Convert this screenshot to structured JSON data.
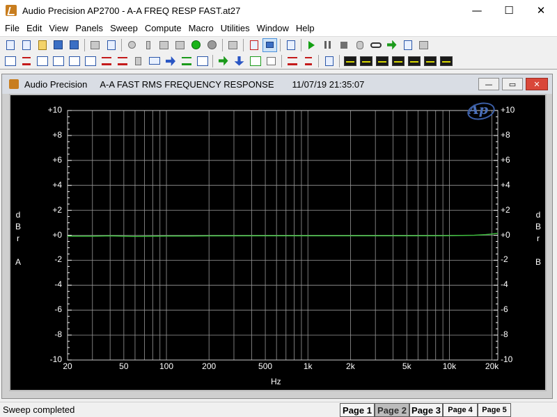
{
  "window": {
    "title": "Audio Precision AP2700 - A-A FREQ RESP FAST.at27",
    "minimize": "—",
    "maximize": "☐",
    "close": "✕"
  },
  "menu": [
    "File",
    "Edit",
    "View",
    "Panels",
    "Sweep",
    "Compute",
    "Macro",
    "Utilities",
    "Window",
    "Help"
  ],
  "toolbar_icons_row1": [
    "new-document",
    "open-document",
    "open-folder",
    "save",
    "save-all",
    "print",
    "print-preview",
    "undo",
    "cut",
    "copy",
    "paste",
    "go-green",
    "stop-gray",
    "settings-panel",
    "record",
    "panel-active",
    "configure",
    "play",
    "pause",
    "stop",
    "hand",
    "glasses",
    "export",
    "import",
    "clipboard"
  ],
  "toolbar_icons_row2": [
    "generator",
    "analyzer",
    "filter",
    "switcher",
    "sync",
    "bits",
    "dsp",
    "waveform",
    "speaker",
    "dcx",
    "digital-io",
    "multitone",
    "compute-cell",
    "arrow-right",
    "arrow-down",
    "graph-view",
    "spreadsheet",
    "bargraph",
    "tree",
    "notes",
    "graph-1",
    "graph-2",
    "graph-3",
    "graph-4",
    "graph-5",
    "graph-6",
    "graph-7"
  ],
  "child_window": {
    "app_name": "Audio Precision",
    "heading": "A-A FAST RMS FREQUENCY RESPONSE",
    "timestamp": "11/07/19 21:35:07",
    "minimize": "—",
    "restore": "▭",
    "close": "✕"
  },
  "chart_data": {
    "type": "line",
    "title": "A-A FAST RMS FREQUENCY RESPONSE",
    "xlabel": "Hz",
    "ylabel_left": [
      "d",
      "B",
      "r",
      "",
      "A"
    ],
    "ylabel_right": [
      "d",
      "B",
      "r",
      "",
      "B"
    ],
    "x_scale": "log",
    "xlim": [
      20,
      22000
    ],
    "ylim": [
      -10,
      10
    ],
    "x_ticks": [
      20,
      50,
      100,
      200,
      500,
      1000,
      2000,
      5000,
      10000,
      20000
    ],
    "x_tick_labels": [
      "20",
      "50",
      "100",
      "200",
      "500",
      "1k",
      "2k",
      "5k",
      "10k",
      "20k"
    ],
    "y_ticks": [
      10,
      8,
      6,
      4,
      2,
      0,
      -2,
      -4,
      -6,
      -8,
      -10
    ],
    "y_tick_labels": [
      "+10",
      "+8",
      "+6",
      "+4",
      "+2",
      "+0",
      "-2",
      "-4",
      "-6",
      "-8",
      "-10"
    ],
    "grid": true,
    "series": [
      {
        "color": "#3fbf3f",
        "x": [
          20,
          30,
          40,
          60,
          80,
          100,
          150,
          200,
          500,
          1000,
          2000,
          5000,
          10000,
          15000,
          18000,
          20000,
          22000
        ],
        "y": [
          -0.08,
          -0.08,
          -0.05,
          -0.1,
          -0.08,
          -0.06,
          -0.06,
          -0.05,
          -0.04,
          -0.04,
          -0.04,
          -0.04,
          -0.03,
          0.0,
          0.05,
          0.1,
          0.15
        ]
      }
    ]
  },
  "status": {
    "text": "Sweep completed",
    "pages": [
      {
        "label": "Page 1",
        "active": false
      },
      {
        "label": "Page 2",
        "active": true
      },
      {
        "label": "Page 3",
        "active": false
      },
      {
        "label": "Page 4",
        "active": false
      },
      {
        "label": "Page 5",
        "active": false
      }
    ]
  }
}
